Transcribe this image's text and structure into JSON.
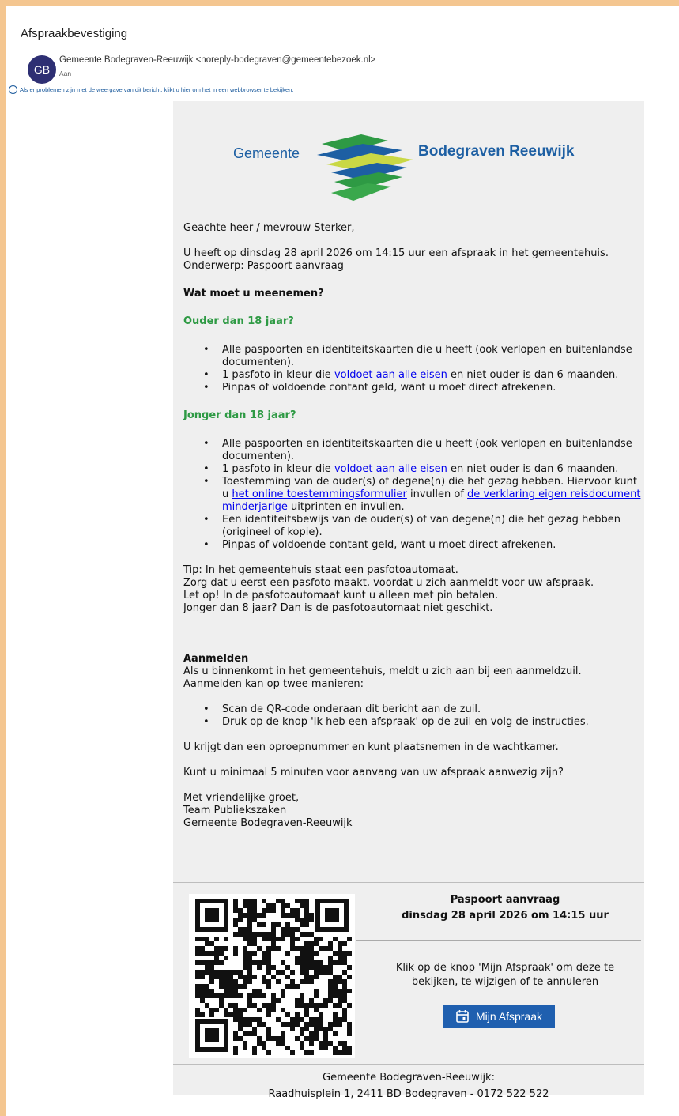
{
  "email": {
    "subject": "Afspraakbevestiging",
    "avatar_initials": "GB",
    "sender": "Gemeente Bodegraven-Reeuwijk <noreply-bodegraven@gemeentebezoek.nl>",
    "to_label": "Aan",
    "info_text": "Als er problemen zijn met de weergave van dit bericht, klikt u hier om het in een webbrowser te bekijken."
  },
  "logo": {
    "left": "Gemeente",
    "right": "Bodegraven Reeuwijk"
  },
  "body": {
    "greeting": "Geachte heer / mevrouw Sterker,",
    "intro1": "U heeft op dinsdag 28 april 2026 om 14:15 uur een afspraak in het gemeentehuis.",
    "intro2": "Onderwerp: Paspoort aanvraag",
    "what_heading": "Wat moet u meenemen?",
    "older_heading": "Ouder dan 18 jaar?",
    "older_items": {
      "item1": "Alle paspoorten en identiteitskaarten die u heeft (ook verlopen en buitenlandse documenten).",
      "item2_pre": "1 pasfoto in kleur die ",
      "item2_link": "voldoet aan alle eisen",
      "item2_post": " en niet ouder is dan 6 maanden.",
      "item3": "Pinpas of voldoende contant geld, want u moet direct afrekenen."
    },
    "younger_heading": "Jonger dan 18 jaar?",
    "younger_items": {
      "item1": "Alle paspoorten en identiteitskaarten die u heeft (ook verlopen en buitenlandse documenten).",
      "item2_pre": "1 pasfoto in kleur die ",
      "item2_link": "voldoet aan alle eisen",
      "item2_post": " en niet ouder is dan 6 maanden.",
      "item3_pre": "Toestemming van de ouder(s) of degene(n) die het gezag hebben. Hiervoor kunt u ",
      "item3_link1": "het online toestemmingsformulier",
      "item3_mid": " invullen of ",
      "item3_link2": "de verklaring eigen reisdocument minderjarige",
      "item3_post": " uitprinten en invullen.",
      "item4": "Een identiteitsbewijs van de ouder(s) of van degene(n) die het gezag hebben (origineel of kopie).",
      "item5": "Pinpas of voldoende contant geld, want u moet direct afrekenen."
    },
    "tip1": "Tip: In het gemeentehuis staat een pasfotoautomaat.",
    "tip2": "Zorg dat u eerst een pasfoto maakt, voordat u zich aanmeldt voor uw afspraak.",
    "tip3": "Let op! In de pasfotoautomaat kunt u alleen met pin betalen.",
    "tip4": "Jonger dan 8 jaar? Dan is de pasfotoautomaat niet geschikt.",
    "aanmelden_heading": "Aanmelden",
    "aanmelden1": "Als u binnenkomt in het gemeentehuis, meldt u zich aan bij een aanmeldzuil.",
    "aanmelden2": "Aanmelden kan op twee manieren:",
    "aanmelden_items": {
      "item1": "Scan de QR-code onderaan dit bericht aan de zuil.",
      "item2": "Druk op de knop 'Ik heb een afspraak' op de zuil en volg de instructies."
    },
    "oproep": "U krijgt dan een oproepnummer en kunt plaatsnemen in de wachtkamer.",
    "minuten": "Kunt u minimaal 5 minuten voor aanvang van uw afspraak aanwezig zijn?",
    "closing1": "Met vriendelijke groet,",
    "closing2": "Team Publiekszaken",
    "closing3": "Gemeente Bodegraven-Reeuwijk"
  },
  "appointment": {
    "title": "Paspoort aanvraag",
    "datetime": "dinsdag 28 april 2026 om 14:15 uur",
    "click_text": "Klik op de knop 'Mijn Afspraak' om deze te bekijken, te wijzigen of te annuleren",
    "button_label": "Mijn Afspraak"
  },
  "footer": {
    "line1": "Gemeente Bodegraven-Reeuwijk:",
    "line2": "Raadhuisplein 1, 2411 BD Bodegraven - 0172 522 522"
  },
  "colors": {
    "frame": "#f4c690",
    "mail_bg": "#efefef",
    "green_heading": "#2e9a44",
    "button": "#1f5faf",
    "logo_blue": "#1d5fa3"
  }
}
